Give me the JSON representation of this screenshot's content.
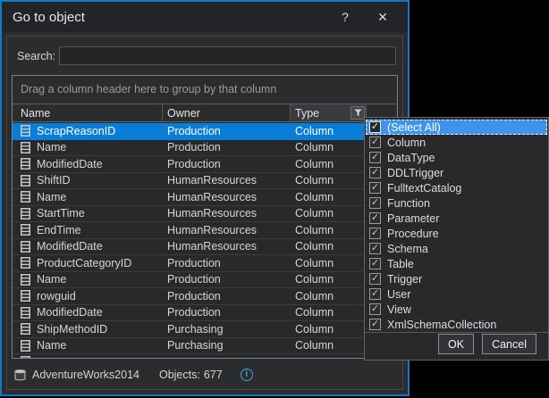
{
  "dialog": {
    "title": "Go to object",
    "help_label": "?",
    "close_label": "✕"
  },
  "search": {
    "label": "Search:",
    "value": ""
  },
  "grid": {
    "group_hint": "Drag a column header here to group by that column",
    "columns": [
      "Name",
      "Owner",
      "Type"
    ],
    "rows": [
      {
        "name": "ScrapReasonID",
        "owner": "Production",
        "type": "Column",
        "selected": true
      },
      {
        "name": "Name",
        "owner": "Production",
        "type": "Column"
      },
      {
        "name": "ModifiedDate",
        "owner": "Production",
        "type": "Column"
      },
      {
        "name": "ShiftID",
        "owner": "HumanResources",
        "type": "Column"
      },
      {
        "name": "Name",
        "owner": "HumanResources",
        "type": "Column"
      },
      {
        "name": "StartTime",
        "owner": "HumanResources",
        "type": "Column"
      },
      {
        "name": "EndTime",
        "owner": "HumanResources",
        "type": "Column"
      },
      {
        "name": "ModifiedDate",
        "owner": "HumanResources",
        "type": "Column"
      },
      {
        "name": "ProductCategoryID",
        "owner": "Production",
        "type": "Column"
      },
      {
        "name": "Name",
        "owner": "Production",
        "type": "Column"
      },
      {
        "name": "rowguid",
        "owner": "Production",
        "type": "Column"
      },
      {
        "name": "ModifiedDate",
        "owner": "Production",
        "type": "Column"
      },
      {
        "name": "ShipMethodID",
        "owner": "Purchasing",
        "type": "Column"
      },
      {
        "name": "Name",
        "owner": "Purchasing",
        "type": "Column"
      }
    ]
  },
  "filter_menu": {
    "check_glyph": "✓",
    "items": [
      {
        "label": "(Select All)",
        "checked": true,
        "selected": true
      },
      {
        "label": "Column",
        "checked": true
      },
      {
        "label": "DataType",
        "checked": true
      },
      {
        "label": "DDLTrigger",
        "checked": true
      },
      {
        "label": "FulltextCatalog",
        "checked": true
      },
      {
        "label": "Function",
        "checked": true
      },
      {
        "label": "Parameter",
        "checked": true
      },
      {
        "label": "Procedure",
        "checked": true
      },
      {
        "label": "Schema",
        "checked": true
      },
      {
        "label": "Table",
        "checked": true
      },
      {
        "label": "Trigger",
        "checked": true
      },
      {
        "label": "User",
        "checked": true
      },
      {
        "label": "View",
        "checked": true
      },
      {
        "label": "XmlSchemaCollection",
        "checked": true
      }
    ],
    "ok_label": "OK",
    "cancel_label": "Cancel"
  },
  "status": {
    "database": "AdventureWorks2014",
    "objects_label": "Objects:",
    "objects_count": "677",
    "info_glyph": "i"
  },
  "colors": {
    "dialog_border": "#1577c0",
    "selection_blue": "#0a7dd7",
    "menu_selection_blue": "#3d94ea",
    "info_icon_blue": "#3aa0e8"
  }
}
